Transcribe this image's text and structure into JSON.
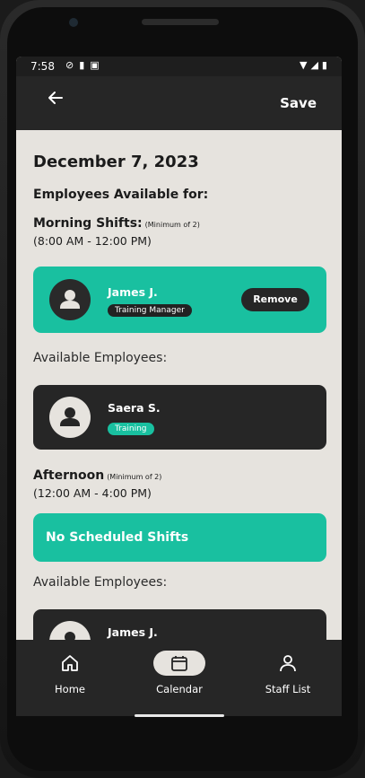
{
  "status": {
    "time": "7:58"
  },
  "appbar": {
    "back_icon": "arrow-left-icon",
    "save_label": "Save"
  },
  "date": "December 7, 2023",
  "employees_available_for": "Employees Available for:",
  "morning": {
    "title": "Morning Shifts:",
    "minimum": "(Minimum of 2)",
    "time": "(8:00 AM - 12:00 PM)",
    "scheduled": {
      "name": "James J.",
      "role": "Training Manager",
      "remove_label": "Remove"
    },
    "available_label": "Available Employees:",
    "available": [
      {
        "name": "Saera S.",
        "role": "Training"
      }
    ]
  },
  "afternoon": {
    "title": "Afternoon",
    "minimum": "(Minimum of 2)",
    "time": "(12:00 AM - 4:00 PM)",
    "no_shifts_label": "No Scheduled Shifts",
    "available_label": "Available Employees:",
    "available": [
      {
        "name": "James J."
      }
    ]
  },
  "nav": {
    "items": [
      {
        "label": "Home",
        "icon": "home-icon"
      },
      {
        "label": "Calendar",
        "icon": "calendar-icon",
        "active": true
      },
      {
        "label": "Staff List",
        "icon": "person-icon"
      }
    ]
  },
  "colors": {
    "accent": "#19c0a0",
    "dark_card": "#262626",
    "background": "#e6e3de"
  }
}
